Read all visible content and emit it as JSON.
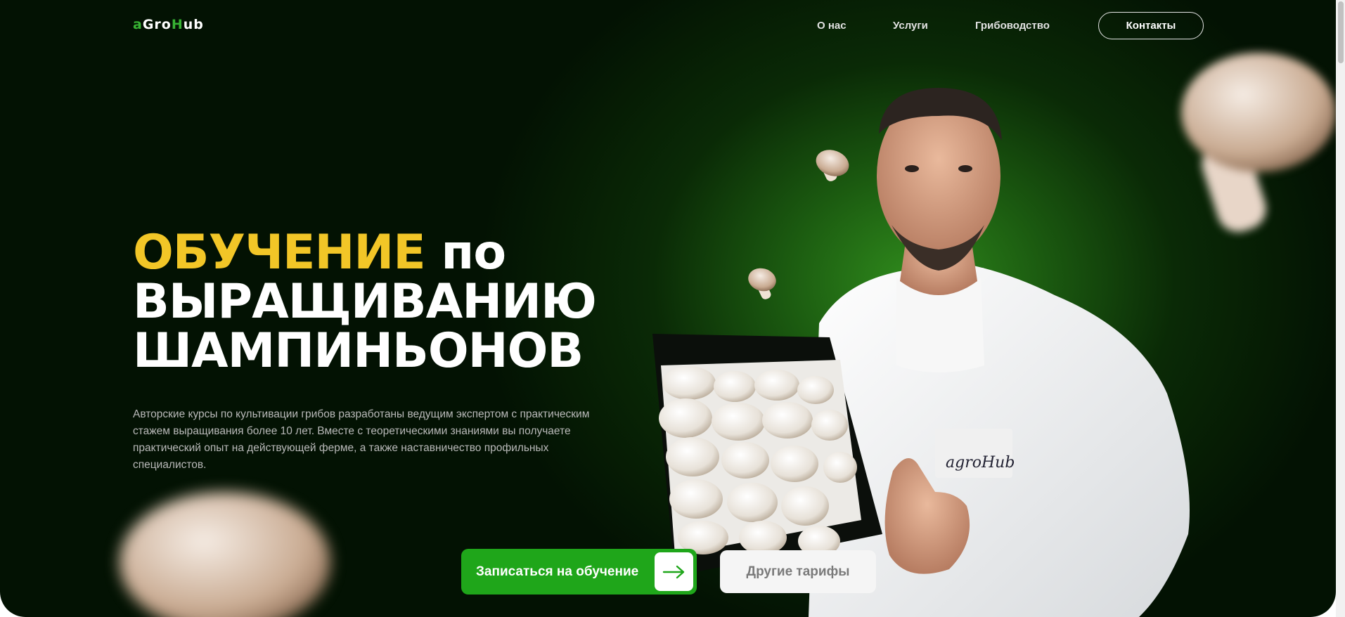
{
  "header": {
    "logo": {
      "part1": "a",
      "part2": "Gro",
      "part3": "H",
      "part4": "ub"
    },
    "nav": [
      {
        "label": "О нас"
      },
      {
        "label": "Услуги"
      },
      {
        "label": "Грибоводство"
      }
    ],
    "contact_label": "Контакты"
  },
  "hero": {
    "headline_accent": "ОБУЧЕНИЕ",
    "headline_line1_rest": " по",
    "headline_line2": "ВЫРАЩИВАНИЮ",
    "headline_line3": "ШАМПИНЬОНОВ",
    "description": "Авторские курсы по культивации грибов разработаны ведущим экспертом с практическим стажем выращивания более 10 лет. Вместе с теоретическими знаниями вы получаете практический опыт на действующей ферме, а также наставничество профильных специалистов.",
    "primary_button": "Записаться на обучение",
    "secondary_button": "Другие тарифы",
    "coat_logo": "agroHub"
  },
  "colors": {
    "accent_yellow": "#f2c627",
    "brand_green": "#1fa61a",
    "background": "#031203"
  },
  "icons": [
    "arrow-right-icon",
    "mushroom-icon"
  ]
}
